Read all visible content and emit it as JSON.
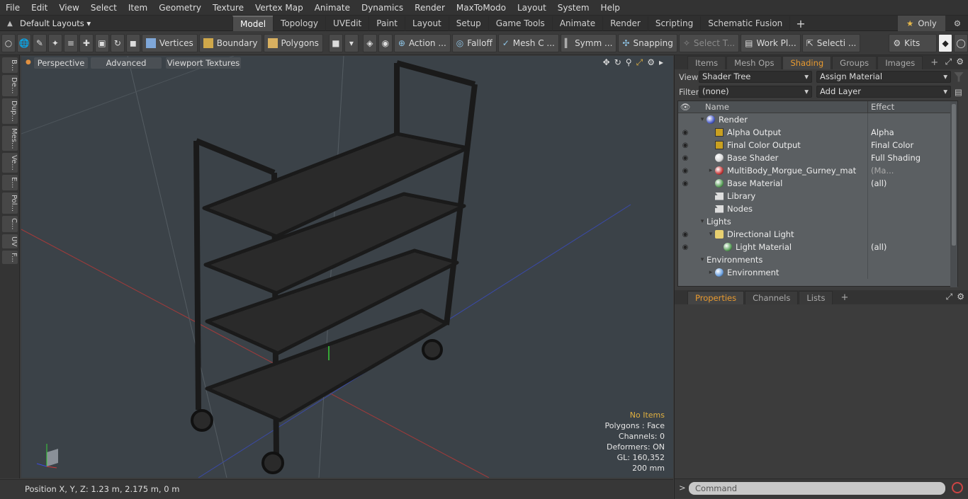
{
  "menu": [
    "File",
    "Edit",
    "View",
    "Select",
    "Item",
    "Geometry",
    "Texture",
    "Vertex Map",
    "Animate",
    "Dynamics",
    "Render",
    "MaxToModo",
    "Layout",
    "System",
    "Help"
  ],
  "layout_selector": "Default Layouts ▾",
  "tabs": [
    "Model",
    "Topology",
    "UVEdit",
    "Paint",
    "Layout",
    "Setup",
    "Game Tools",
    "Animate",
    "Render",
    "Scripting",
    "Schematic Fusion"
  ],
  "tab_plus": "+",
  "only_label": "Only",
  "toolbar": {
    "vertices": "Vertices",
    "boundary": "Boundary",
    "polygons": "Polygons",
    "action": "Action",
    "falloff": "Falloff",
    "mesh": "Mesh C ...",
    "symm": "Symm ...",
    "snapping": "Snapping",
    "select_t": "Select T...",
    "workplane": "Work Pl...",
    "selecti": "Selecti ...",
    "kits": "Kits"
  },
  "left_tabs": [
    "B...",
    "De...",
    "Dup...",
    "Mes...",
    "Ve...",
    "E...",
    "Pol...",
    "C...",
    "UV",
    "F..."
  ],
  "viewport": {
    "perspective": "Perspective",
    "advanced": "Advanced",
    "textures": "Viewport Textures",
    "info": [
      "No Items",
      "Polygons : Face",
      "Channels: 0",
      "Deformers: ON",
      "GL: 160,352",
      "200 mm"
    ]
  },
  "status": "Position X, Y, Z:   1.23 m, 2.175 m, 0 m",
  "panel": {
    "tabs": [
      "Items",
      "Mesh Ops",
      "Shading",
      "Groups",
      "Images"
    ],
    "active_tab": "Shading",
    "view_label": "View",
    "view_value": "Shader Tree",
    "assign_material": "Assign Material",
    "filter_label": "Filter",
    "filter_value": "(none)",
    "add_layer": "Add Layer",
    "col_name": "Name",
    "col_effect": "Effect",
    "rows": [
      {
        "name": "Render",
        "effect": "",
        "eye": false,
        "indent": 0,
        "twisty": "▾",
        "icon": "render-sphere",
        "swatch": "#4a5cc8",
        "dd": false
      },
      {
        "name": "Alpha Output",
        "effect": "Alpha",
        "eye": true,
        "indent": 1,
        "twisty": "",
        "icon": "output",
        "swatch": "",
        "dd": true
      },
      {
        "name": "Final Color Output",
        "effect": "Final Color",
        "eye": true,
        "indent": 1,
        "twisty": "",
        "icon": "output",
        "swatch": "",
        "dd": true
      },
      {
        "name": "Base Shader",
        "effect": "Full Shading",
        "eye": true,
        "indent": 1,
        "twisty": "",
        "icon": "shader",
        "swatch": "#d8d8d8",
        "dd": true
      },
      {
        "name": "MultiBody_Morgue_Gurney_mat",
        "effect": "(Ma...",
        "eye": true,
        "indent": 1,
        "twisty": "▸",
        "icon": "material",
        "swatch": "#c83a3a",
        "dd": true,
        "muted": true
      },
      {
        "name": "Base Material",
        "effect": "(all)",
        "eye": true,
        "indent": 1,
        "twisty": "",
        "icon": "material",
        "swatch": "#5aa05a",
        "dd": true
      },
      {
        "name": "Library",
        "effect": "",
        "eye": false,
        "indent": 1,
        "twisty": "",
        "icon": "folder",
        "swatch": "",
        "dd": false
      },
      {
        "name": "Nodes",
        "effect": "",
        "eye": false,
        "indent": 1,
        "twisty": "",
        "icon": "folder",
        "swatch": "",
        "dd": false
      },
      {
        "name": "Lights",
        "effect": "",
        "eye": false,
        "indent": 0,
        "twisty": "▾",
        "icon": "",
        "swatch": "",
        "dd": false
      },
      {
        "name": "Directional Light",
        "effect": "",
        "eye": true,
        "indent": 1,
        "twisty": "▾",
        "icon": "light",
        "swatch": "",
        "dd": false
      },
      {
        "name": "Light Material",
        "effect": "(all)",
        "eye": true,
        "indent": 2,
        "twisty": "",
        "icon": "material",
        "swatch": "#5aa05a",
        "dd": true
      },
      {
        "name": "Environments",
        "effect": "",
        "eye": false,
        "indent": 0,
        "twisty": "▾",
        "icon": "",
        "swatch": "",
        "dd": false
      },
      {
        "name": "Environment",
        "effect": "",
        "eye": false,
        "indent": 1,
        "twisty": "▸",
        "icon": "environment",
        "swatch": "#6aa0e0",
        "dd": false
      }
    ],
    "lower_tabs": [
      "Properties",
      "Channels",
      "Lists"
    ],
    "lower_active": "Properties",
    "command_placeholder": "Command"
  }
}
